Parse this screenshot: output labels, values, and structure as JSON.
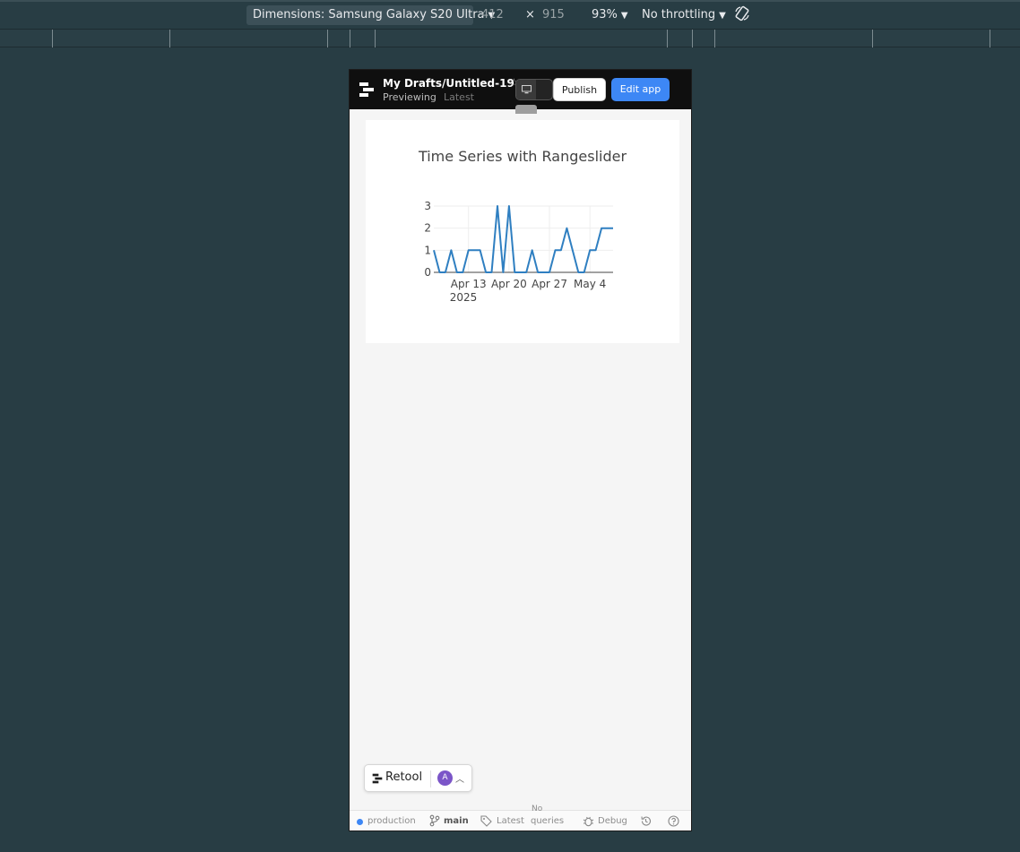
{
  "devtools": {
    "device_label": "Dimensions: Samsung Galaxy S20 Ultra",
    "width": "412",
    "times": "×",
    "height": "915",
    "zoom": "93%",
    "throttling": "No throttling"
  },
  "app": {
    "title": "My Drafts/Untitled-19",
    "status": "Previewing",
    "version": "Latest",
    "publish_label": "Publish",
    "edit_label": "Edit app",
    "accent": "#3d87f5"
  },
  "chart_data": {
    "type": "line",
    "title": "Time Series with Rangeslider",
    "x_tick_labels": [
      "Apr 13",
      "Apr 20",
      "Apr 27",
      "May 4"
    ],
    "x_year_label": "2025",
    "y_tick_labels": [
      "0",
      "1",
      "2",
      "3"
    ],
    "ylim": [
      0,
      3
    ],
    "grid": true,
    "series": [
      {
        "color": "#2f7fc1",
        "x": [
          "2025-04-07",
          "2025-04-08",
          "2025-04-09",
          "2025-04-10",
          "2025-04-11",
          "2025-04-12",
          "2025-04-13",
          "2025-04-14",
          "2025-04-15",
          "2025-04-16",
          "2025-04-17",
          "2025-04-18",
          "2025-04-19",
          "2025-04-20",
          "2025-04-21",
          "2025-04-22",
          "2025-04-23",
          "2025-04-24",
          "2025-04-25",
          "2025-04-26",
          "2025-04-27",
          "2025-04-28",
          "2025-04-29",
          "2025-04-30",
          "2025-05-01",
          "2025-05-02",
          "2025-05-03",
          "2025-05-04",
          "2025-05-05",
          "2025-05-06",
          "2025-05-07",
          "2025-05-08"
        ],
        "values": [
          1,
          0,
          0,
          1,
          0,
          0,
          1,
          1,
          1,
          0,
          0,
          3,
          0,
          3,
          0,
          0,
          0,
          1,
          0,
          0,
          0,
          1,
          1,
          2,
          1,
          0,
          0,
          1,
          1,
          2,
          2,
          2
        ]
      }
    ]
  },
  "widget": {
    "brand": "Retool",
    "avatar_initial": "A"
  },
  "status_bar": {
    "environment": "production",
    "branch": "main",
    "release": "Latest",
    "queries_top": "No",
    "queries": "queries",
    "debug": "Debug"
  }
}
